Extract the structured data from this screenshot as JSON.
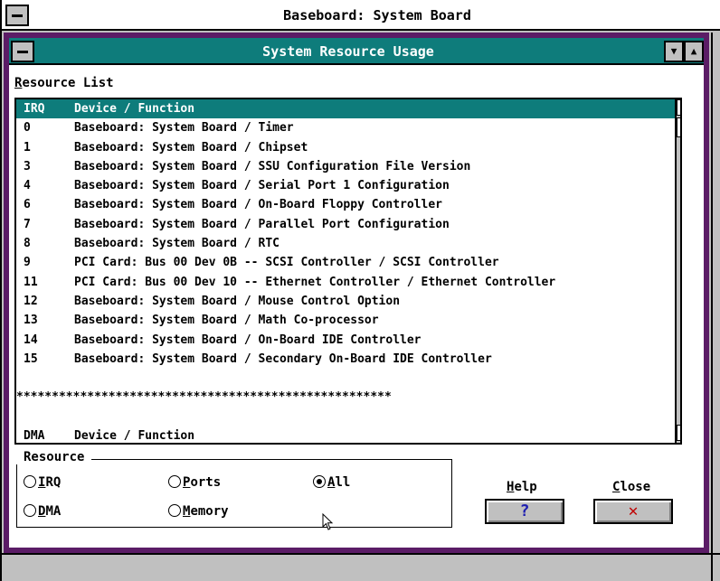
{
  "outer_window": {
    "title": "Baseboard: System Board"
  },
  "dialog": {
    "title": "System Resource Usage",
    "resource_list_label_first": "R",
    "resource_list_label_rest": "esource List",
    "list": {
      "header": {
        "col1": "IRQ",
        "col2": "Device / Function"
      },
      "rows": [
        {
          "col1": "0",
          "col2": "Baseboard: System Board / Timer"
        },
        {
          "col1": "1",
          "col2": "Baseboard: System Board / Chipset"
        },
        {
          "col1": "3",
          "col2": "Baseboard: System Board / SSU Configuration File Version"
        },
        {
          "col1": "4",
          "col2": "Baseboard: System Board / Serial Port 1 Configuration"
        },
        {
          "col1": "6",
          "col2": "Baseboard: System Board / On-Board Floppy Controller"
        },
        {
          "col1": "7",
          "col2": "Baseboard: System Board / Parallel Port Configuration"
        },
        {
          "col1": "8",
          "col2": "Baseboard: System Board / RTC"
        },
        {
          "col1": "9",
          "col2": "PCI Card: Bus 00 Dev 0B -- SCSI Controller / SCSI Controller"
        },
        {
          "col1": "11",
          "col2": "PCI Card: Bus 00 Dev 10 -- Ethernet Controller / Ethernet Controller"
        },
        {
          "col1": "12",
          "col2": "Baseboard: System Board / Mouse Control Option"
        },
        {
          "col1": "13",
          "col2": "Baseboard: System Board / Math Co-processor"
        },
        {
          "col1": "14",
          "col2": "Baseboard: System Board / On-Board IDE Controller"
        },
        {
          "col1": "15",
          "col2": "Baseboard: System Board / Secondary On-Board IDE Controller"
        }
      ],
      "separator": "*****************************************************",
      "dma_header": {
        "col1": "DMA",
        "col2": "Device / Function"
      }
    },
    "resource_group": {
      "title": "Resource",
      "irq_label": "IRQ",
      "irq_underline": "I",
      "dma_label": "DMA",
      "dma_underline": "D",
      "ports_underline": "P",
      "ports_rest": "orts",
      "memory_underline": "M",
      "memory_rest": "emory",
      "all_underline": "A",
      "all_rest": "ll",
      "selected": "All"
    },
    "help": {
      "label_first": "H",
      "label_rest": "elp",
      "glyph": "?"
    },
    "close": {
      "label_first": "C",
      "label_rest": "lose",
      "glyph": "✕"
    }
  },
  "colors": {
    "title_bar": "#0e7c7b",
    "dialog_border": "#5b1c66",
    "face": "#c0c0c0"
  }
}
